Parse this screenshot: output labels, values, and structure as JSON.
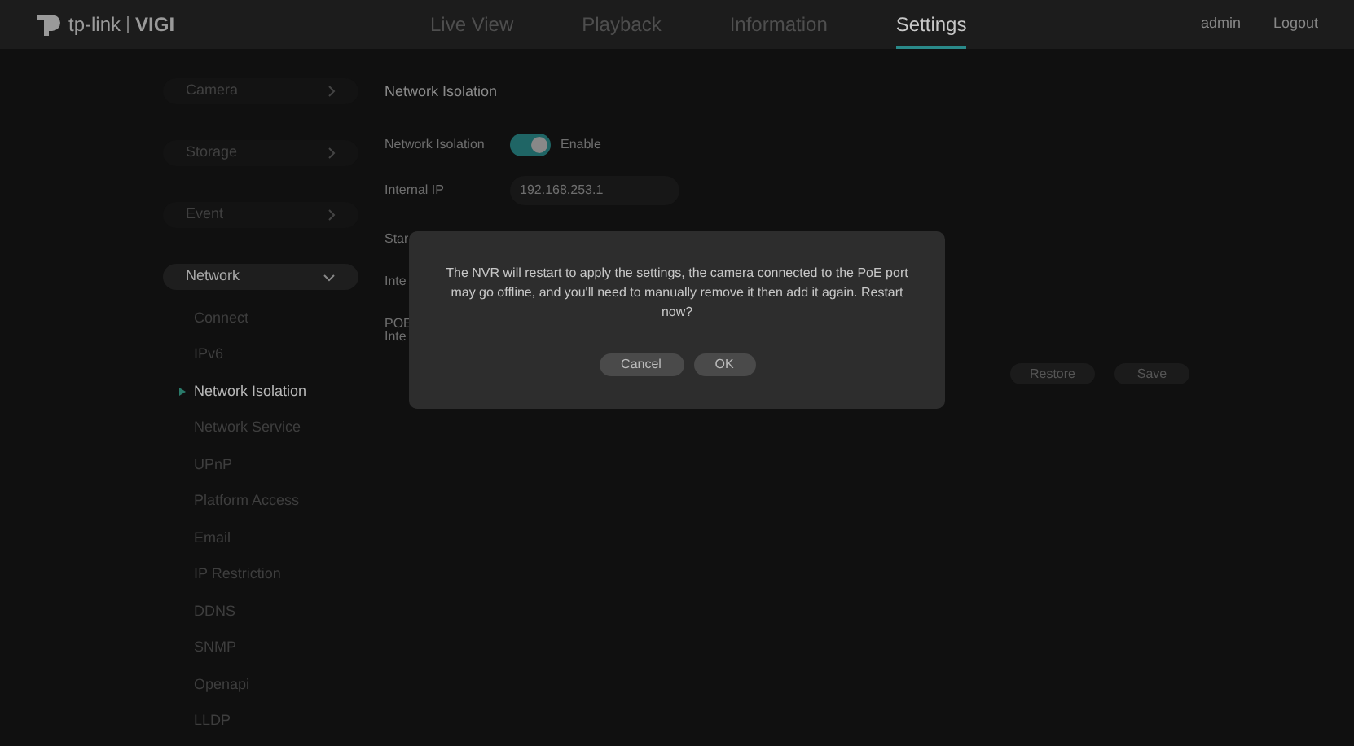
{
  "header": {
    "brand": "tp-link",
    "product": "VIGI",
    "nav": [
      {
        "label": "Live View",
        "selected": false
      },
      {
        "label": "Playback",
        "selected": false
      },
      {
        "label": "Information",
        "selected": false
      },
      {
        "label": "Settings",
        "selected": true
      }
    ],
    "user": "admin",
    "logout": "Logout"
  },
  "sidebar": {
    "groups": [
      {
        "label": "Camera",
        "expanded": false
      },
      {
        "label": "Storage",
        "expanded": false
      },
      {
        "label": "Event",
        "expanded": false
      },
      {
        "label": "Network",
        "expanded": true,
        "children": [
          {
            "label": "Connect",
            "selected": false
          },
          {
            "label": "IPv6",
            "selected": false
          },
          {
            "label": "Network Isolation",
            "selected": true
          },
          {
            "label": "Network Service",
            "selected": false
          },
          {
            "label": "UPnP",
            "selected": false
          },
          {
            "label": "Platform Access",
            "selected": false
          },
          {
            "label": "Email",
            "selected": false
          },
          {
            "label": "IP Restriction",
            "selected": false
          },
          {
            "label": "DDNS",
            "selected": false
          },
          {
            "label": "SNMP",
            "selected": false
          },
          {
            "label": "Openapi",
            "selected": false
          },
          {
            "label": "LLDP",
            "selected": false
          }
        ]
      }
    ]
  },
  "content": {
    "title": "Network Isolation",
    "toggle": {
      "label": "Network Isolation",
      "on": true,
      "text": "Enable"
    },
    "internal_ip": {
      "label": "Internal IP",
      "value": "192.168.253.1"
    },
    "covered_labels": [
      [
        "Star"
      ],
      [
        "Inte"
      ],
      [
        "POE",
        "Inte"
      ]
    ],
    "buttons": [
      "Restore",
      "Save"
    ]
  },
  "dialog": {
    "message": "The NVR will restart to apply the settings, the camera connected to the PoE port may go offline, and you'll need to manually remove it then add it again. Restart now?",
    "buttons": [
      "Cancel",
      "OK"
    ]
  }
}
